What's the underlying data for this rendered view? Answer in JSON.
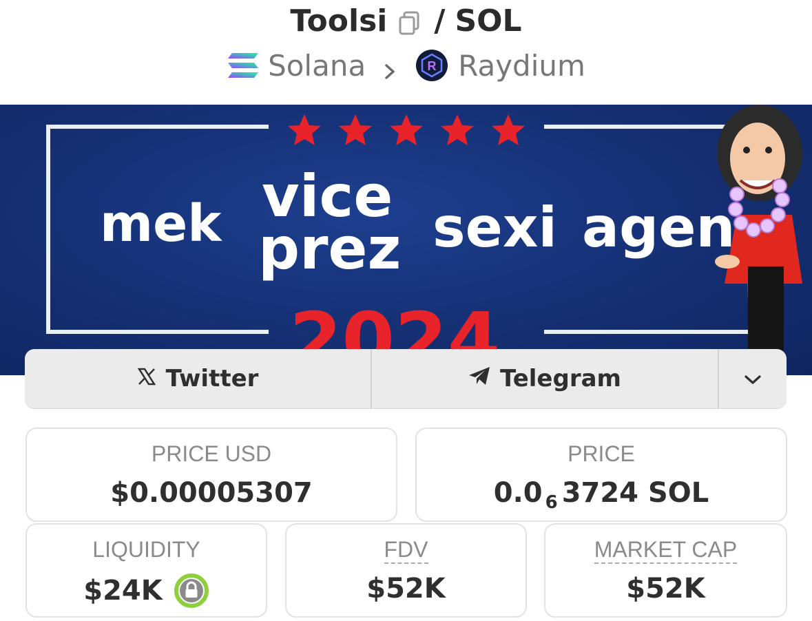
{
  "header": {
    "token_name": "Toolsi",
    "separator": "/",
    "quote_token": "SOL",
    "chain": "Solana",
    "dex": "Raydium"
  },
  "banner": {
    "words": [
      "mek",
      "vice",
      "prez",
      "sexi",
      "agen",
      "2024"
    ]
  },
  "links": {
    "twitter_label": "Twitter",
    "telegram_label": "Telegram"
  },
  "stats": {
    "price_usd": {
      "label": "PRICE USD",
      "value": "$0.00005307"
    },
    "price": {
      "label": "PRICE",
      "value_prefix": "0.0",
      "value_subscript": "6",
      "value_suffix": "3724 SOL"
    },
    "liquidity": {
      "label": "LIQUIDITY",
      "value": "$24K"
    },
    "fdv": {
      "label": "FDV",
      "value": "$52K"
    },
    "market_cap": {
      "label": "MARKET CAP",
      "value": "$52K"
    }
  },
  "colors": {
    "banner_blue": "#152f72",
    "star_red": "#e8232a",
    "lock_green": "#8fcf3e",
    "card_border": "#e3e3e3"
  }
}
